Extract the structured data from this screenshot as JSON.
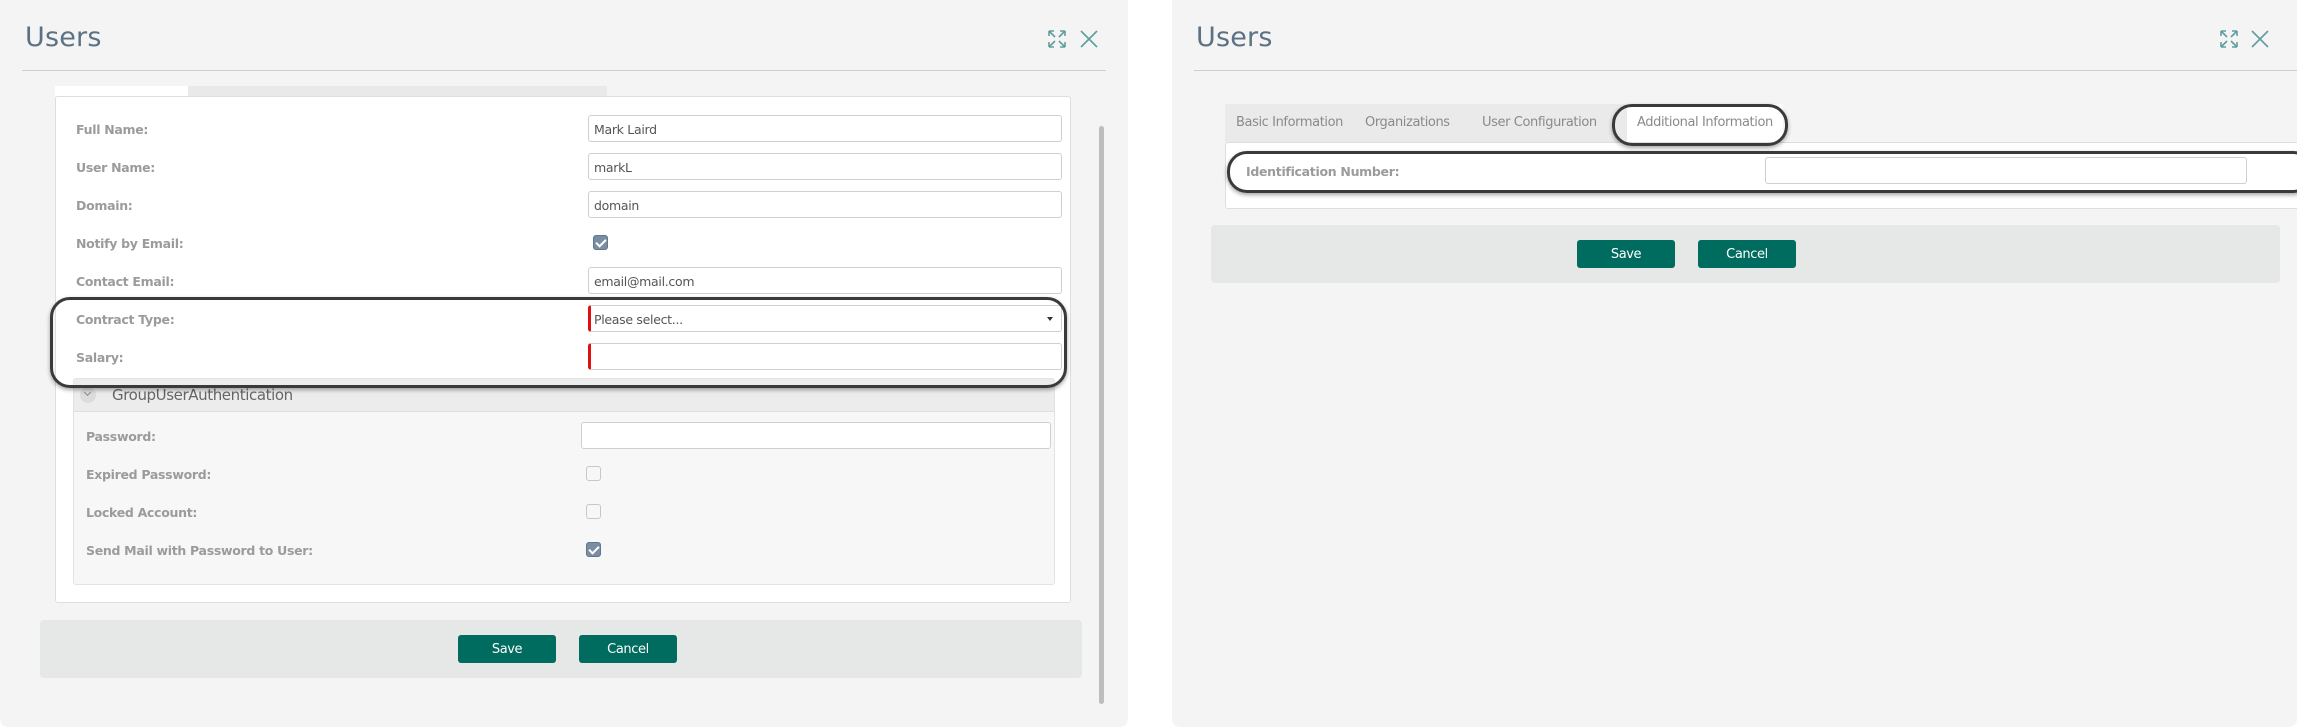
{
  "left_dialog": {
    "title": "Users",
    "icons": {
      "maximize": "expand-arrows-icon",
      "close": "close-x-icon"
    },
    "fields": [
      {
        "label": "Full Name:",
        "type": "text",
        "value": "Mark Laird"
      },
      {
        "label": "User Name:",
        "type": "text",
        "value": "markL"
      },
      {
        "label": "Domain:",
        "type": "text",
        "value": "domain"
      },
      {
        "label": "Notify by Email:",
        "type": "checkbox",
        "checked": true
      },
      {
        "label": "Contact Email:",
        "type": "text",
        "value": "email@mail.com"
      },
      {
        "label": "Contract Type:",
        "type": "select",
        "value": "Please select...",
        "required": true
      },
      {
        "label": "Salary:",
        "type": "text",
        "value": "",
        "required": true
      }
    ],
    "group": {
      "title": "GroupUserAuthentication",
      "expanded": true,
      "fields": [
        {
          "label": "Password:",
          "type": "password",
          "value": ""
        },
        {
          "label": "Expired Password:",
          "type": "checkbox",
          "checked": false
        },
        {
          "label": "Locked Account:",
          "type": "checkbox",
          "checked": false
        },
        {
          "label": "Send Mail with Password to User:",
          "type": "checkbox",
          "checked": true
        }
      ]
    },
    "buttons": {
      "save": "Save",
      "cancel": "Cancel"
    }
  },
  "right_dialog": {
    "title": "Users",
    "icons": {
      "maximize": "expand-arrows-icon",
      "close": "close-x-icon"
    },
    "tabs": [
      {
        "label": "Basic Information",
        "active": false
      },
      {
        "label": "Organizations",
        "active": false
      },
      {
        "label": "User Configuration",
        "active": false
      },
      {
        "label": "Additional Information",
        "active": true
      }
    ],
    "fields": [
      {
        "label": "Identification Number:",
        "type": "text",
        "value": ""
      }
    ],
    "buttons": {
      "save": "Save",
      "cancel": "Cancel"
    }
  },
  "colors": {
    "accent": "#006c5f",
    "title": "#5b7184",
    "required": "#e01010",
    "background": "#f4f4f4"
  }
}
